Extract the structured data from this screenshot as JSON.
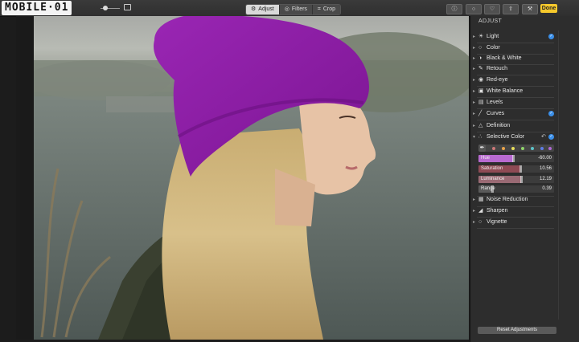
{
  "watermark": "MOBILE·01",
  "toolbar": {
    "tabs": [
      {
        "label": "Adjust",
        "glyph": "⚙",
        "active": true
      },
      {
        "label": "Filters",
        "glyph": "◎",
        "active": false
      },
      {
        "label": "Crop",
        "glyph": "⌗",
        "active": false
      }
    ],
    "done_label": "Done",
    "icons": [
      "info-icon",
      "compare-icon",
      "favorite-icon",
      "share-icon",
      "tools-icon"
    ]
  },
  "panel": {
    "title": "ADJUST",
    "items": [
      {
        "label": "Light",
        "icon": "☀",
        "checked": true
      },
      {
        "label": "Color",
        "icon": "○",
        "checked": false
      },
      {
        "label": "Black & White",
        "icon": "◑",
        "checked": false
      },
      {
        "label": "Retouch",
        "icon": "✎",
        "checked": false
      },
      {
        "label": "Red-eye",
        "icon": "◉",
        "checked": false
      },
      {
        "label": "White Balance",
        "icon": "▣",
        "checked": false
      },
      {
        "label": "Levels",
        "icon": "▤",
        "checked": false
      },
      {
        "label": "Curves",
        "icon": "╱",
        "checked": true
      },
      {
        "label": "Definition",
        "icon": "△",
        "checked": false
      },
      {
        "label": "Selective Color",
        "icon": "∴",
        "checked": true
      }
    ],
    "selective_color": {
      "swatches": [
        "#c77",
        "#e9a44a",
        "#e8de5a",
        "#8fd46a",
        "#5cc3c9",
        "#5d7de6",
        "#b169d6"
      ],
      "sliders": [
        {
          "label": "Hue",
          "value": "-60.00",
          "fill": 0.46,
          "color": "#b86ad0"
        },
        {
          "label": "Saturation",
          "value": "10.56",
          "fill": 0.55,
          "color": "#8e4a54"
        },
        {
          "label": "Luminance",
          "value": "12.19",
          "fill": 0.56,
          "color": "#9a6a74"
        },
        {
          "label": "Range",
          "value": "0.39",
          "fill": 0.18,
          "color": "#5a5a5a"
        }
      ]
    },
    "items_after": [
      {
        "label": "Noise Reduction",
        "icon": "▦"
      },
      {
        "label": "Sharpen",
        "icon": "◢"
      },
      {
        "label": "Vignette",
        "icon": "○"
      }
    ],
    "reset_label": "Reset Adjustments"
  },
  "colors": {
    "accent": "#3b8fe8",
    "done": "#f6c92c",
    "hat": "#8e1aa6"
  }
}
